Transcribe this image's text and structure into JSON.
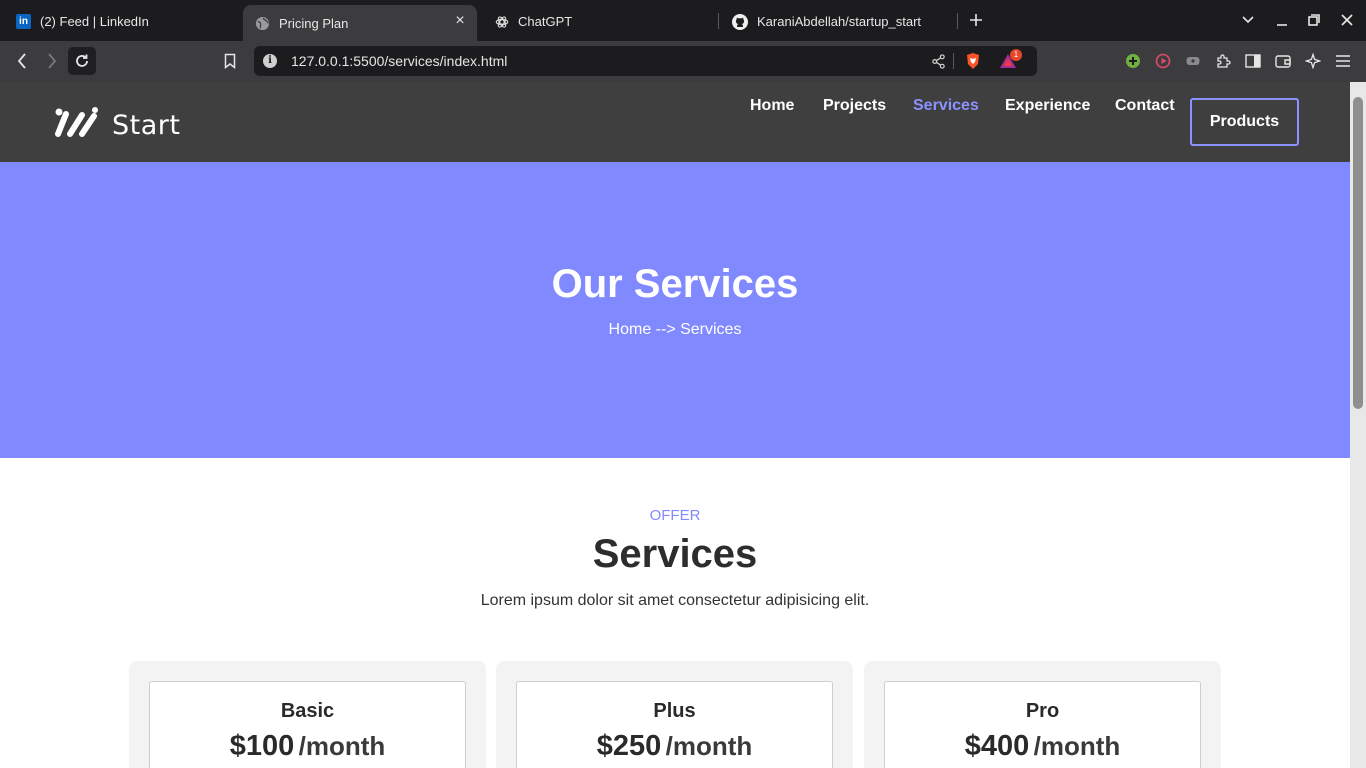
{
  "browser": {
    "tabs": [
      {
        "title": "(2) Feed | LinkedIn",
        "icon": "linkedin-icon",
        "favicon_letters": "in",
        "active": false
      },
      {
        "title": "Pricing Plan",
        "icon": "globe-icon",
        "active": true
      },
      {
        "title": "ChatGPT",
        "icon": "chatgpt-icon",
        "active": false
      },
      {
        "title": "KaraniAbdellah/startup_start",
        "icon": "github-icon",
        "active": false
      }
    ],
    "url": "127.0.0.1:5500/services/index.html",
    "notification_count": "1",
    "colors": {
      "tab_bg": "#1c1c1e",
      "toolbar_bg": "#3c3c3f",
      "brave_orange": "#fb542b"
    }
  },
  "site": {
    "logo_text": "Start",
    "nav": [
      {
        "label": "Home",
        "active": false
      },
      {
        "label": "Projects",
        "active": false
      },
      {
        "label": "Services",
        "active": true
      },
      {
        "label": "Experience",
        "active": false
      },
      {
        "label": "Contact",
        "active": false
      }
    ],
    "nav_cta": "Products",
    "colors": {
      "header_bg": "#3f3f3f",
      "accent": "#8189ff",
      "nav_active": "#8b92ff"
    }
  },
  "hero": {
    "title": "Our Services",
    "breadcrumb": "Home --> Services"
  },
  "services_section": {
    "kicker": "OFFER",
    "title": "Services",
    "subtitle": "Lorem ipsum dolor sit amet consectetur adipisicing elit."
  },
  "plans": [
    {
      "name": "Basic",
      "price": "$100",
      "period": "/month"
    },
    {
      "name": "Plus",
      "price": "$250",
      "period": "/month"
    },
    {
      "name": "Pro",
      "price": "$400",
      "period": "/month"
    }
  ]
}
